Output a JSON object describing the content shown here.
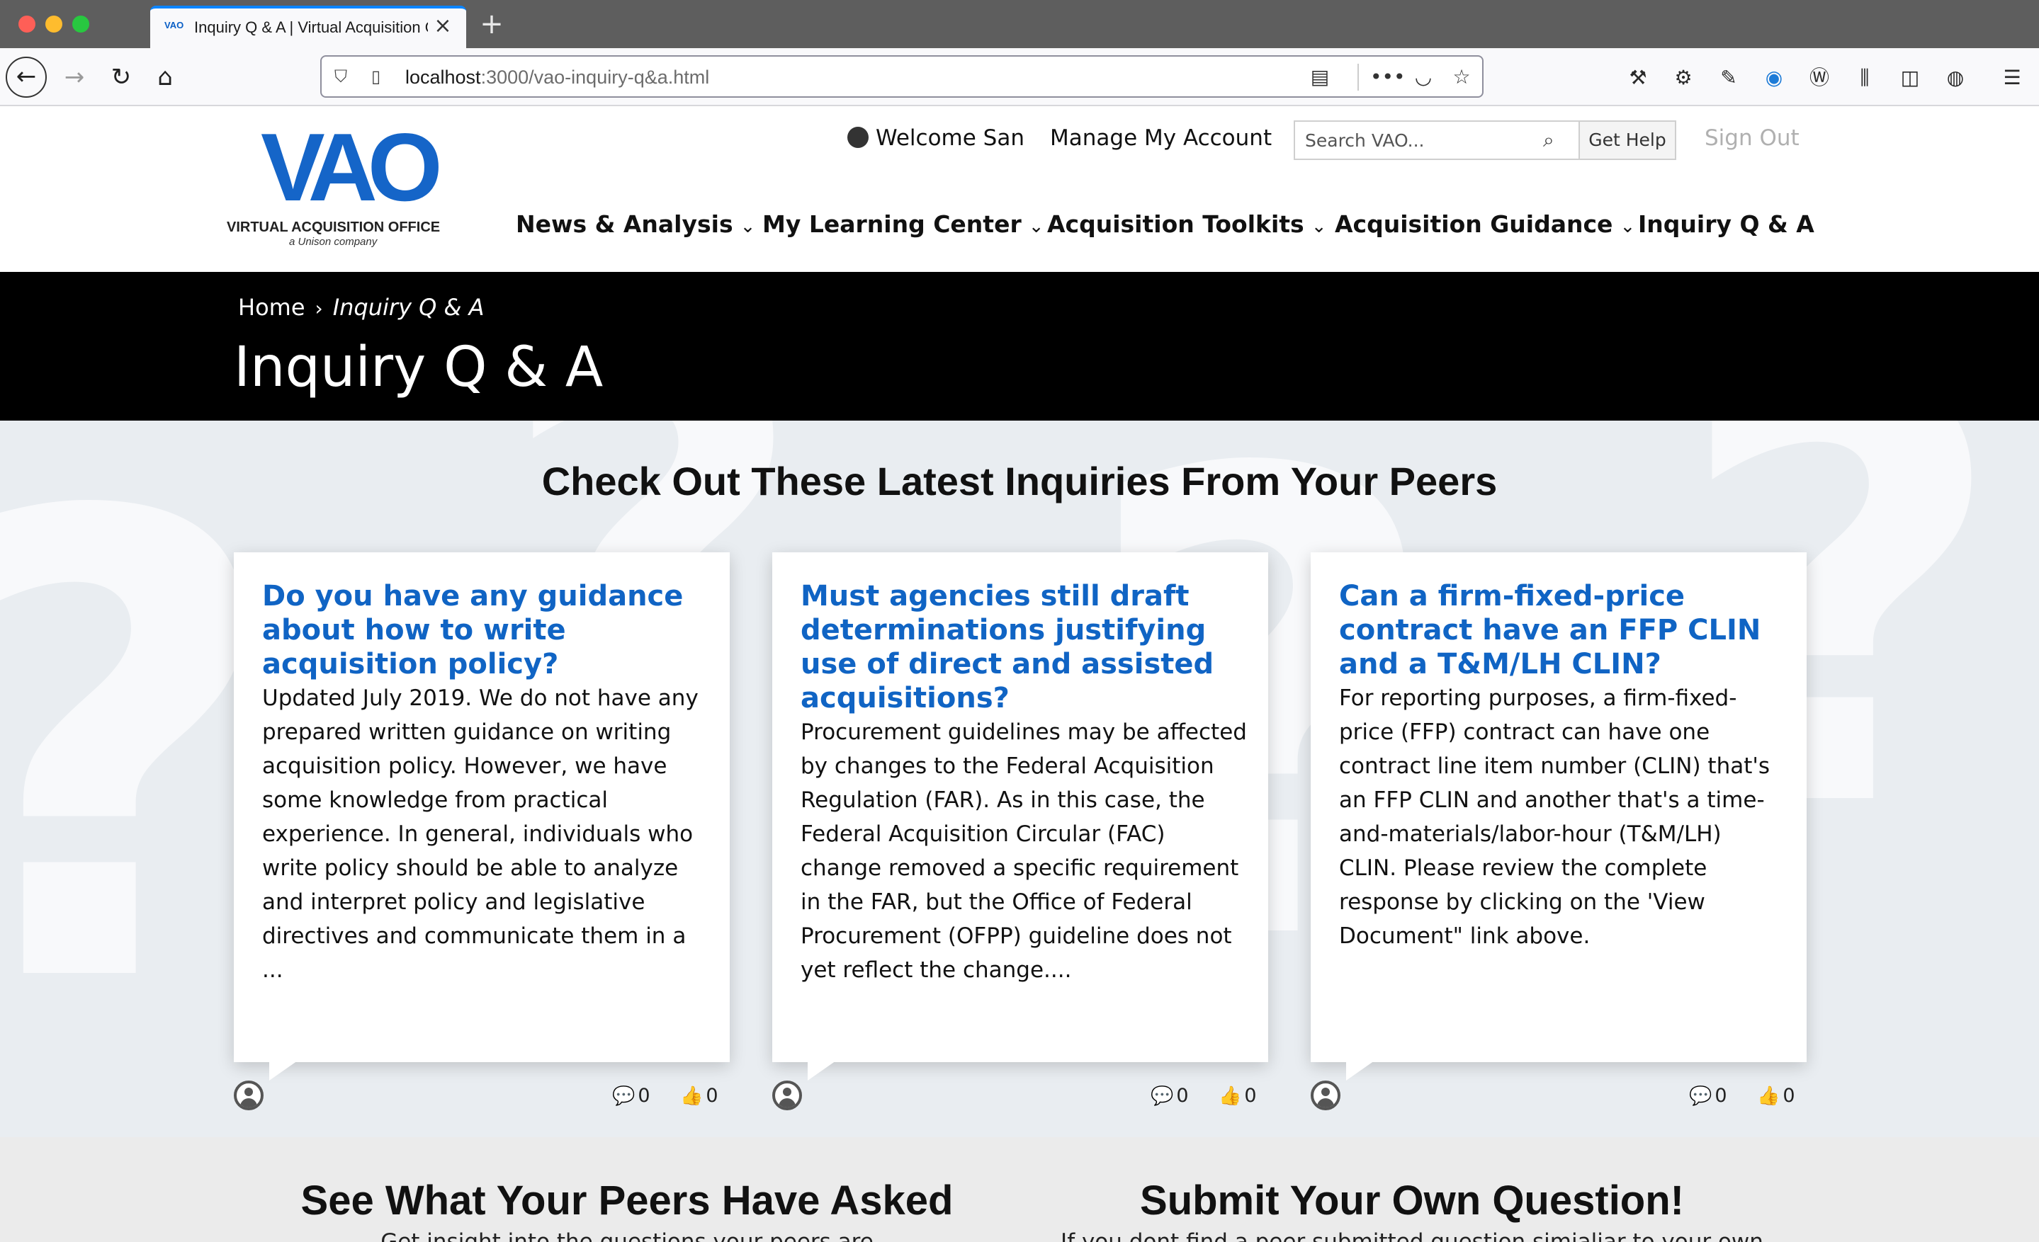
{
  "browser": {
    "tab_title": "Inquiry Q & A | Virtual Acquisition Office",
    "tab_favicon": "VAO",
    "url_host": "localhost",
    "url_path": ":3000/vao-inquiry-q&a.html",
    "icons": [
      "back-icon",
      "forward-icon",
      "reload-icon",
      "home-icon",
      "shield-icon",
      "page-icon",
      "reader-view-icon",
      "more-icon",
      "pocket-icon",
      "bookmark-star-icon",
      "wrench-icon",
      "gear-icon",
      "eyedropper-icon",
      "extension-icon",
      "wordpress-icon",
      "library-icon",
      "sidebar-icon",
      "account-icon",
      "menu-icon"
    ]
  },
  "header": {
    "logo_mark": "VAO",
    "logo_name": "VIRTUAL ACQUISITION OFFICE",
    "logo_tagline": "a Unison company",
    "welcome": "Welcome San",
    "manage_account": "Manage My Account",
    "search_placeholder": "Search VAO...",
    "get_help": "Get Help",
    "sign_out": "Sign Out",
    "nav": [
      {
        "label": "News & Analysis"
      },
      {
        "label": "My Learning Center"
      },
      {
        "label": "Acquisition Toolkits"
      },
      {
        "label": "Acquisition Guidance"
      },
      {
        "label": "Inquiry Q & A"
      }
    ]
  },
  "hero": {
    "breadcrumb_home": "Home",
    "breadcrumb_current": "Inquiry Q & A",
    "title": "Inquiry Q & A"
  },
  "inquiries": {
    "heading": "Check Out These Latest Inquiries From Your Peers",
    "cards": [
      {
        "title": "Do you have any guidance about how to write acquisition policy?",
        "body": "Updated July 2019. We do not have any prepared written guidance on writing acquisition policy. However, we have some knowledge from practical experience. In general, individuals who write policy should be able to analyze and interpret policy and legislative directives and communicate them in a ...",
        "comments": "0",
        "likes": "0"
      },
      {
        "title": "Must agencies still draft determinations justifying use of direct and assisted acquisitions?",
        "body": "Procurement guidelines may be affected by changes to the Federal Acquisition Regulation (FAR). As in this case, the Federal Acquisition Circular (FAC) change removed a specific requirement in the FAR, but the Office of Federal Procurement (OFPP) guideline does not yet reflect the change....",
        "comments": "0",
        "likes": "0"
      },
      {
        "title": "Can a firm-fixed-price contract have an FFP CLIN and a T&M/LH CLIN?",
        "body": "For reporting purposes, a firm-fixed-price (FFP) contract can have one contract line item number (CLIN) that's an FFP CLIN and another that's a time-and-materials/labor-hour (T&M/LH) CLIN. Please review the complete response by clicking on the 'View Document\" link above.",
        "comments": "0",
        "likes": "0"
      }
    ]
  },
  "bottom": {
    "left_title": "See What Your Peers Have Asked",
    "left_sub": "Get insight into the questions your peers are",
    "right_title": "Submit Your Own Question!",
    "right_sub": "If you dont find a peer submitted question simialiar to your own"
  },
  "colors": {
    "brand_blue": "#1565c8",
    "link_blue": "#1064c4",
    "hero_bg": "#000000",
    "section_bg": "#e9edf1"
  }
}
